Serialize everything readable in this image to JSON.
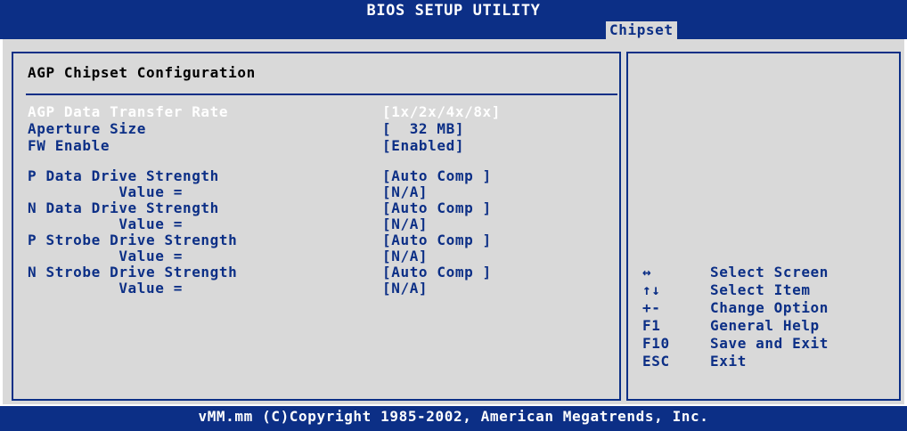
{
  "header": {
    "title": "BIOS SETUP UTILITY",
    "active_tab": "Chipset"
  },
  "section": {
    "title": "AGP Chipset Configuration"
  },
  "settings": [
    {
      "label": "AGP Data Transfer Rate",
      "value": "[1x/2x/4x/8x]",
      "disabled": true
    },
    {
      "label": "Aperture Size",
      "value": "[  32 MB]"
    },
    {
      "label": "FW Enable",
      "value": "[Enabled]"
    },
    {
      "label": "P Data Drive Strength",
      "value": "[Auto Comp ]"
    },
    {
      "label": "          Value =",
      "value": "[N/A]"
    },
    {
      "label": "N Data Drive Strength",
      "value": "[Auto Comp ]"
    },
    {
      "label": "          Value =",
      "value": "[N/A]"
    },
    {
      "label": "P Strobe Drive Strength",
      "value": "[Auto Comp ]"
    },
    {
      "label": "          Value =",
      "value": "[N/A]"
    },
    {
      "label": "N Strobe Drive Strength",
      "value": "[Auto Comp ]"
    },
    {
      "label": "          Value =",
      "value": "[N/A]"
    }
  ],
  "help": [
    {
      "key": "↔",
      "desc": "Select Screen"
    },
    {
      "key": "↑↓",
      "desc": "Select Item"
    },
    {
      "key": "+-",
      "desc": "Change Option"
    },
    {
      "key": "F1",
      "desc": "General Help"
    },
    {
      "key": "F10",
      "desc": "Save and Exit"
    },
    {
      "key": "ESC",
      "desc": "Exit"
    }
  ],
  "footer": {
    "copyright": "vMM.mm (C)Copyright 1985-2002, American Megatrends, Inc."
  },
  "colors": {
    "blue": "#0c2f86",
    "gray": "#d9d9d9",
    "white": "#ffffff"
  }
}
